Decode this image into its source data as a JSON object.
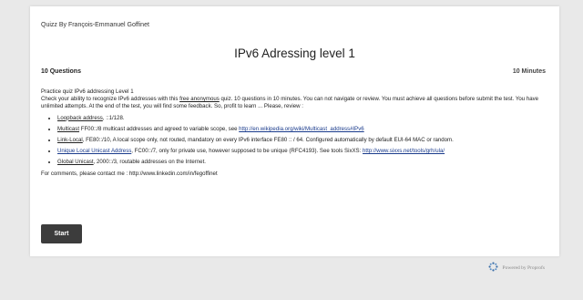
{
  "header": {
    "author": "Quizz By François-Emmanuel Goffinet",
    "title": "IPv6 Adressing level 1",
    "question_count": "10 Questions",
    "duration": "10 Minutes"
  },
  "intro": {
    "line1": "Practice quiz IPv6 addressing Level 1",
    "line2_pre": "Check your ability to recognize IPv6 addresses with this ",
    "line2_link": "free anonymous",
    "line2_post": " quiz. 10 questions in 10 minutes. You can not navigate or review. You must achieve all questions before submit the test. You have unlimited attempts. At the end of the test, you will find some feedback. So, profit to learn ... Please, review :"
  },
  "topics": {
    "loopback": {
      "term": "Loopback address",
      "text": ", ::1/128."
    },
    "multicast": {
      "term": "Multicast",
      "text": " FF00::/8 multicast addresses and agreed to variable scope, see ",
      "link": "http://en.wikipedia.org/wiki/Multicast_address#IPv6"
    },
    "linklocal": {
      "term": "Link-Local",
      "text": ", FE80::/10, A local scope only, not routed, mandatory on every IPv6 interface FE80 :: / 64. Configured automatically by default EUI-64 MAC or random."
    },
    "ula": {
      "term": "Unique Local Unicast Address",
      "text": ", FC00::/7, only for private use, however supposed to be unique (RFC4193). See tools SixXS: ",
      "link": "http://www.sixxs.net/tools/grh/ula/"
    },
    "global": {
      "term": "Global Unicast",
      "text": ", 2000::/3, routable addresses on the Internet."
    }
  },
  "contact": {
    "text": "For comments, please contact me : ",
    "link": "http://www.linkedin.com/in/fegoffinet"
  },
  "start_button": "Start",
  "footer": {
    "powered_by": "Powered by Proprofs"
  },
  "colors": {
    "background": "#e9e9e9",
    "card": "#ffffff",
    "button": "#3c3c3c",
    "link": "#1a3b8c"
  },
  "icons": {
    "brand": "proprofs-logo-icon"
  }
}
